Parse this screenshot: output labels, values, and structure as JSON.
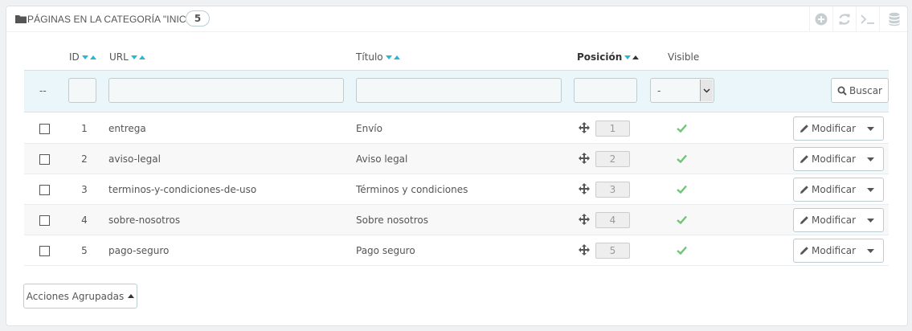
{
  "panel": {
    "title": "Páginas en la categoría \"Inicio\"",
    "count": "5",
    "tools": [
      "add-icon",
      "refresh-icon",
      "terminal-icon",
      "database-icon"
    ]
  },
  "columns": {
    "id": "ID",
    "url": "URL",
    "title": "Título",
    "position": "Posición",
    "visible": "Visible"
  },
  "filters": {
    "dash": "--",
    "id_value": "",
    "url_value": "",
    "title_value": "",
    "position_value": "",
    "visible_selected": "-",
    "search_label": "Buscar"
  },
  "rows": [
    {
      "id": "1",
      "url": "entrega",
      "title": "Envío",
      "position": "1",
      "visible": true
    },
    {
      "id": "2",
      "url": "aviso-legal",
      "title": "Aviso legal",
      "position": "2",
      "visible": true
    },
    {
      "id": "3",
      "url": "terminos-y-condiciones-de-uso",
      "title": "Términos y condiciones",
      "position": "3",
      "visible": true
    },
    {
      "id": "4",
      "url": "sobre-nosotros",
      "title": "Sobre nosotros",
      "position": "4",
      "visible": true
    },
    {
      "id": "5",
      "url": "pago-seguro",
      "title": "Pago seguro",
      "position": "5",
      "visible": true
    }
  ],
  "row_action": "Modificar",
  "bulk_actions_label": "Acciones Agrupadas",
  "colors": {
    "accent": "#25b9d7",
    "check": "#72c279",
    "filter_bg": "#ebf6fb"
  }
}
